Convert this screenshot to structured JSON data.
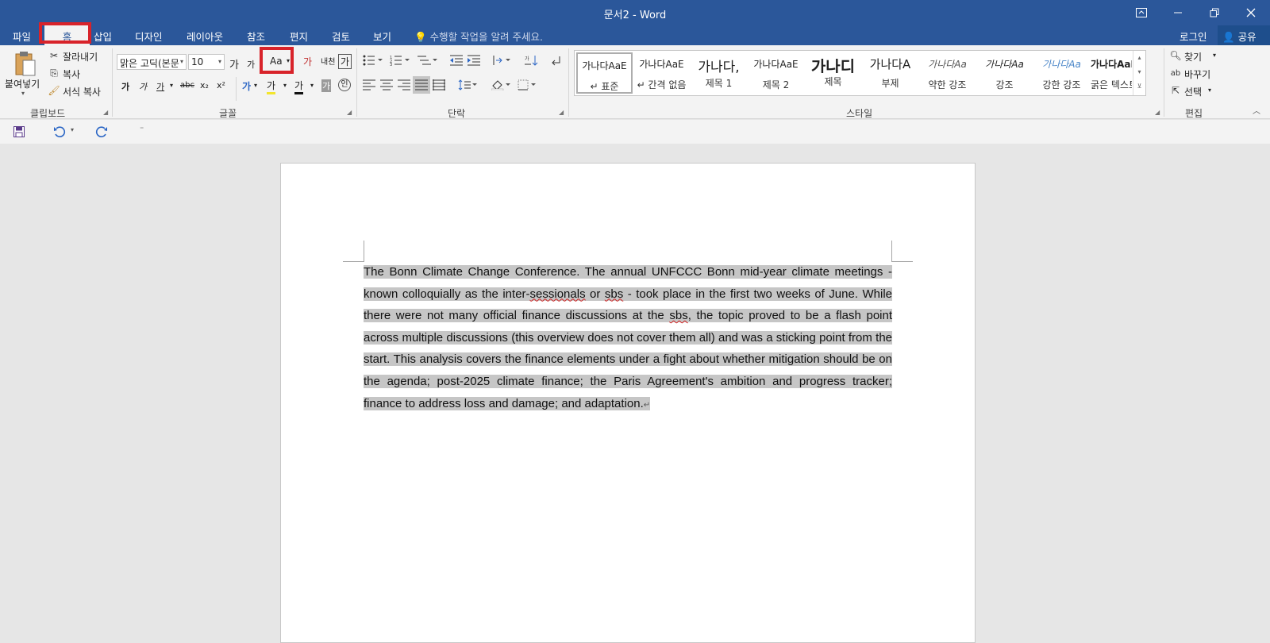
{
  "window": {
    "title": "문서2 - Word",
    "controls": [
      "ribbon-display",
      "minimize",
      "restore",
      "close"
    ]
  },
  "tabs": [
    {
      "label": "파일"
    },
    {
      "label": "홈",
      "active": true
    },
    {
      "label": "삽입"
    },
    {
      "label": "디자인"
    },
    {
      "label": "레이아웃"
    },
    {
      "label": "참조"
    },
    {
      "label": "편지"
    },
    {
      "label": "검토"
    },
    {
      "label": "보기"
    }
  ],
  "tell_me": "수행할 작업을 알려 주세요.",
  "login": "로그인",
  "share": "공유",
  "clipboard": {
    "paste": "붙여넣기",
    "cut": "잘라내기",
    "copy": "복사",
    "format_painter": "서식 복사",
    "group": "클립보드"
  },
  "font": {
    "name": "맑은 고딕(본문",
    "size": "10",
    "grow": "가",
    "shrink": "가",
    "change_case": "Aa",
    "clear_format": "가",
    "phonetic": "내천",
    "char_border": "가",
    "bold": "가",
    "italic": "가",
    "underline": "가",
    "strike": "abc",
    "subscript": "x₂",
    "superscript": "x²",
    "text_effect": "가",
    "highlight": "가",
    "font_color": "가",
    "char_shading": "가",
    "enclosed": "인",
    "group": "글꼴"
  },
  "paragraph": {
    "group": "단락"
  },
  "styles": {
    "group": "스타일",
    "items": [
      {
        "sample": "가나다AaE",
        "name": "↵ 표준"
      },
      {
        "sample": "가나다AaE",
        "name": "↵ 간격 없음"
      },
      {
        "sample": "가나다,",
        "name": "제목 1"
      },
      {
        "sample": "가나다AaE",
        "name": "제목 2"
      },
      {
        "sample": "가나디",
        "name": "제목"
      },
      {
        "sample": "가나다A",
        "name": "부제"
      },
      {
        "sample": "가나다Aa",
        "name": "약한 강조"
      },
      {
        "sample": "가나다Aa",
        "name": "강조"
      },
      {
        "sample": "가나다Aa",
        "name": "강한 강조"
      },
      {
        "sample": "가나다AaE",
        "name": "굵은 텍스트"
      }
    ]
  },
  "editing": {
    "find": "찾기",
    "replace": "바꾸기",
    "select": "선택",
    "group": "편집"
  },
  "document": {
    "text_start": "The Bonn Climate Change Conference. The annual UNFCCC Bonn mid-year climate meetings - known colloquially as the inter-",
    "w1": "sessionals",
    "t2": " or ",
    "w2": "sbs",
    "t3": " - took place in the first two weeks of June. While there were not many official finance discussions at the ",
    "w3": "sbs",
    "t4": ", the topic proved to be a flash point across multiple discussions (this overview does not cover them all) and was a sticking point from the start. This analysis covers the finance elements under a fight about whether mitigation should be on the agenda; post-2025 climate finance; the Paris Agreement's ambition and progress tracker; finance to address loss and damage; and adaptation.",
    "para_mark": "↵"
  },
  "colors": {
    "brand": "#2b579a",
    "highlight_box": "#d8232a",
    "selection": "#c6c6c6"
  }
}
